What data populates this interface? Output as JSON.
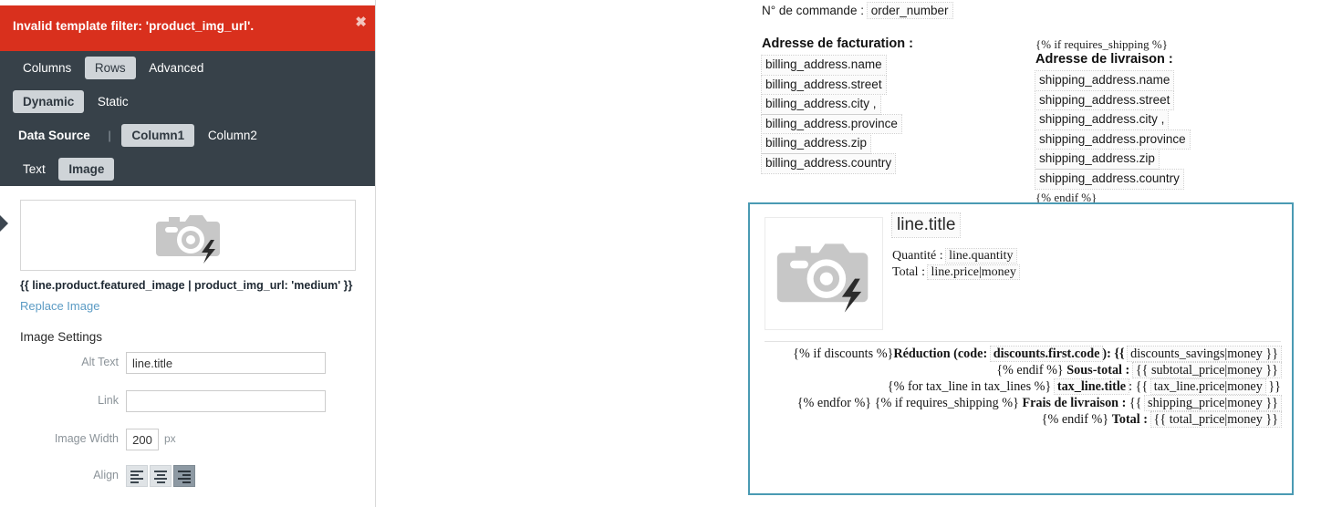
{
  "editor": {
    "alert": {
      "message": "Invalid template filter: 'product_img_url'.",
      "close_label": "✖"
    },
    "tabs": [
      {
        "label": "Columns",
        "active": false
      },
      {
        "label": "Rows",
        "active": true
      },
      {
        "label": "Advanced",
        "active": false
      }
    ],
    "modes": [
      {
        "label": "Dynamic",
        "active": true
      },
      {
        "label": "Static",
        "active": false
      }
    ],
    "source": {
      "label": "Data Source",
      "divider": "|",
      "columns": [
        {
          "label": "Column1",
          "active": true
        },
        {
          "label": "Column2",
          "active": false
        }
      ]
    },
    "content_types": [
      {
        "label": "Text",
        "active": false
      },
      {
        "label": "Image",
        "active": true
      }
    ],
    "preview": {
      "placeholder_icon": "broken-image-camera-icon",
      "liquid_expression": "{{ line.product.featured_image | product_img_url: 'medium' }}",
      "replace_link": "Replace Image"
    },
    "settings": {
      "title": "Image Settings",
      "alt_text": {
        "label": "Alt Text",
        "value": "line.title",
        "placeholder": ""
      },
      "link": {
        "label": "Link",
        "value": "",
        "placeholder": ""
      },
      "image_width": {
        "label": "Image Width",
        "value": "200",
        "unit": "px"
      },
      "align": {
        "label": "Align",
        "options": [
          {
            "name": "align-left",
            "active": false
          },
          {
            "name": "align-center",
            "active": false
          },
          {
            "name": "align-right",
            "active": true
          }
        ]
      }
    },
    "colors": {
      "alert_bg": "#d9301d",
      "toolbar_bg": "#374149",
      "active_pill_bg": "#cfd4d8",
      "link": "#5b9bc4"
    }
  },
  "preview": {
    "order": {
      "label": "N° de commande :",
      "value": "order_number"
    },
    "billing": {
      "heading": "Adresse de facturation :",
      "lines": [
        "billing_address.name",
        "billing_address.street",
        "billing_address.city ,",
        "billing_address.province",
        "billing_address.zip",
        "billing_address.country"
      ]
    },
    "shipping": {
      "open_tag": "{% if requires_shipping %}",
      "heading": "Adresse de livraison :",
      "lines": [
        "shipping_address.name",
        "shipping_address.street",
        "shipping_address.city ,",
        "shipping_address.province",
        "shipping_address.zip",
        "shipping_address.country"
      ],
      "close_tag": "{% endif %}"
    },
    "line_item": {
      "thumb_icon": "broken-image-camera-icon",
      "title": "line.title",
      "quantity_label": "Quantité :",
      "quantity_value": "line.quantity",
      "total_label": "Total :",
      "total_value": "line.price|money"
    },
    "totals": {
      "discount_open": "{% if discounts %}",
      "discount_label": "Réduction (code:",
      "discount_code": "discounts.first.code",
      "discount_label_end": "): {{",
      "discount_value": "discounts_savings|money }}",
      "endif_1": "{% endif %}",
      "subtotal_label": "Sous-total :",
      "subtotal_value": "{{ subtotal_price|money }}",
      "tax_for": "{% for tax_line in tax_lines %}",
      "tax_title": "tax_line.title",
      "tax_sep": ": {{",
      "tax_value": "tax_line.price|money",
      "tax_close": "}}",
      "endfor": "{% endfor %}",
      "shipping_if": "{% if requires_shipping %}",
      "shipping_label": "Frais de livraison :",
      "shipping_open_braces": "{{",
      "shipping_value": "shipping_price|money }}",
      "endif_2": "{% endif %}",
      "total_label": "Total :",
      "total_value": "{{ total_price|money }}"
    },
    "colors": {
      "selection_border": "#4a9ab3",
      "liquid_chip_bg": "#fbfbfb"
    }
  }
}
